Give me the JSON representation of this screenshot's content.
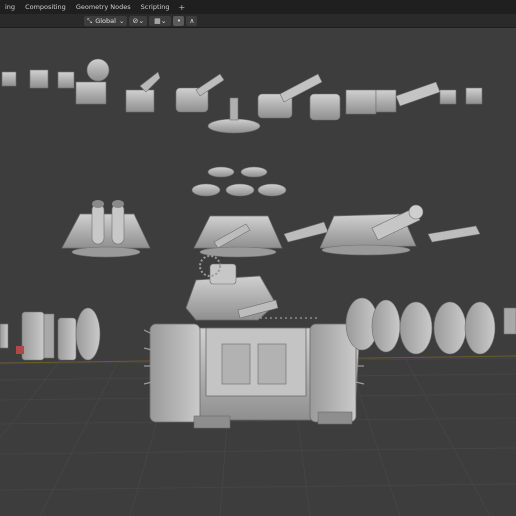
{
  "workspace_tabs": [
    {
      "label": "ing"
    },
    {
      "label": "Compositing"
    },
    {
      "label": "Geometry Nodes"
    },
    {
      "label": "Scripting"
    }
  ],
  "add_tab_label": "+",
  "header": {
    "transform_orientation": "Global",
    "pivot_icon": "transform-pivot-icon",
    "snap_icon": "snap-icon",
    "proportional_icon": "proportional-edit-icon",
    "falloff_icon": "falloff-curve-icon"
  },
  "colors": {
    "viewport_bg": "#3d3d3d",
    "grid_line": "#474747",
    "horizon_line": "#6b5a2e",
    "model_light": "#c9c9c9",
    "model_mid": "#a8a8a8",
    "model_dark": "#7a7a7a"
  }
}
